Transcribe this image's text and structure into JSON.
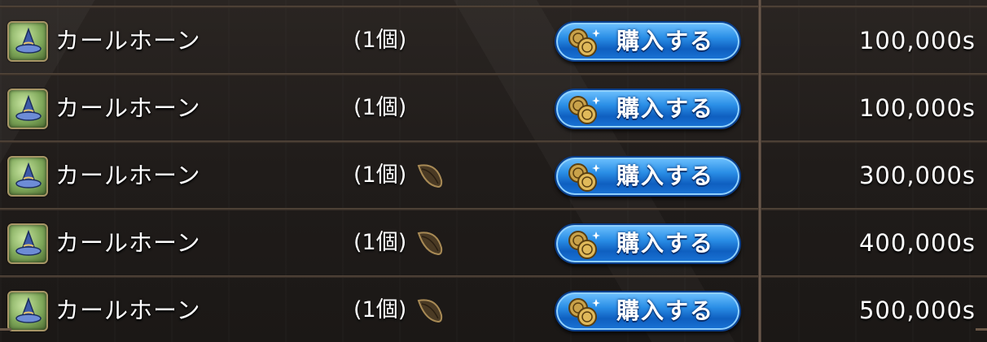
{
  "shop": {
    "items": [
      {
        "name": "カールホーン",
        "qty": "(1個)",
        "has_seed_icon": false,
        "buy_label": "購入する",
        "price": "100,000s"
      },
      {
        "name": "カールホーン",
        "qty": "(1個)",
        "has_seed_icon": false,
        "buy_label": "購入する",
        "price": "100,000s"
      },
      {
        "name": "カールホーン",
        "qty": "(1個)",
        "has_seed_icon": true,
        "buy_label": "購入する",
        "price": "300,000s"
      },
      {
        "name": "カールホーン",
        "qty": "(1個)",
        "has_seed_icon": true,
        "buy_label": "購入する",
        "price": "400,000s"
      },
      {
        "name": "カールホーン",
        "qty": "(1個)",
        "has_seed_icon": true,
        "buy_label": "購入する",
        "price": "500,000s"
      }
    ],
    "icons": {
      "item": "wizard-hat-icon",
      "seed": "seed-icon",
      "coin": "coin-icon"
    },
    "colors": {
      "button_blue": "#2a8ee6",
      "text": "#ffffff",
      "background": "#201c1a"
    }
  }
}
